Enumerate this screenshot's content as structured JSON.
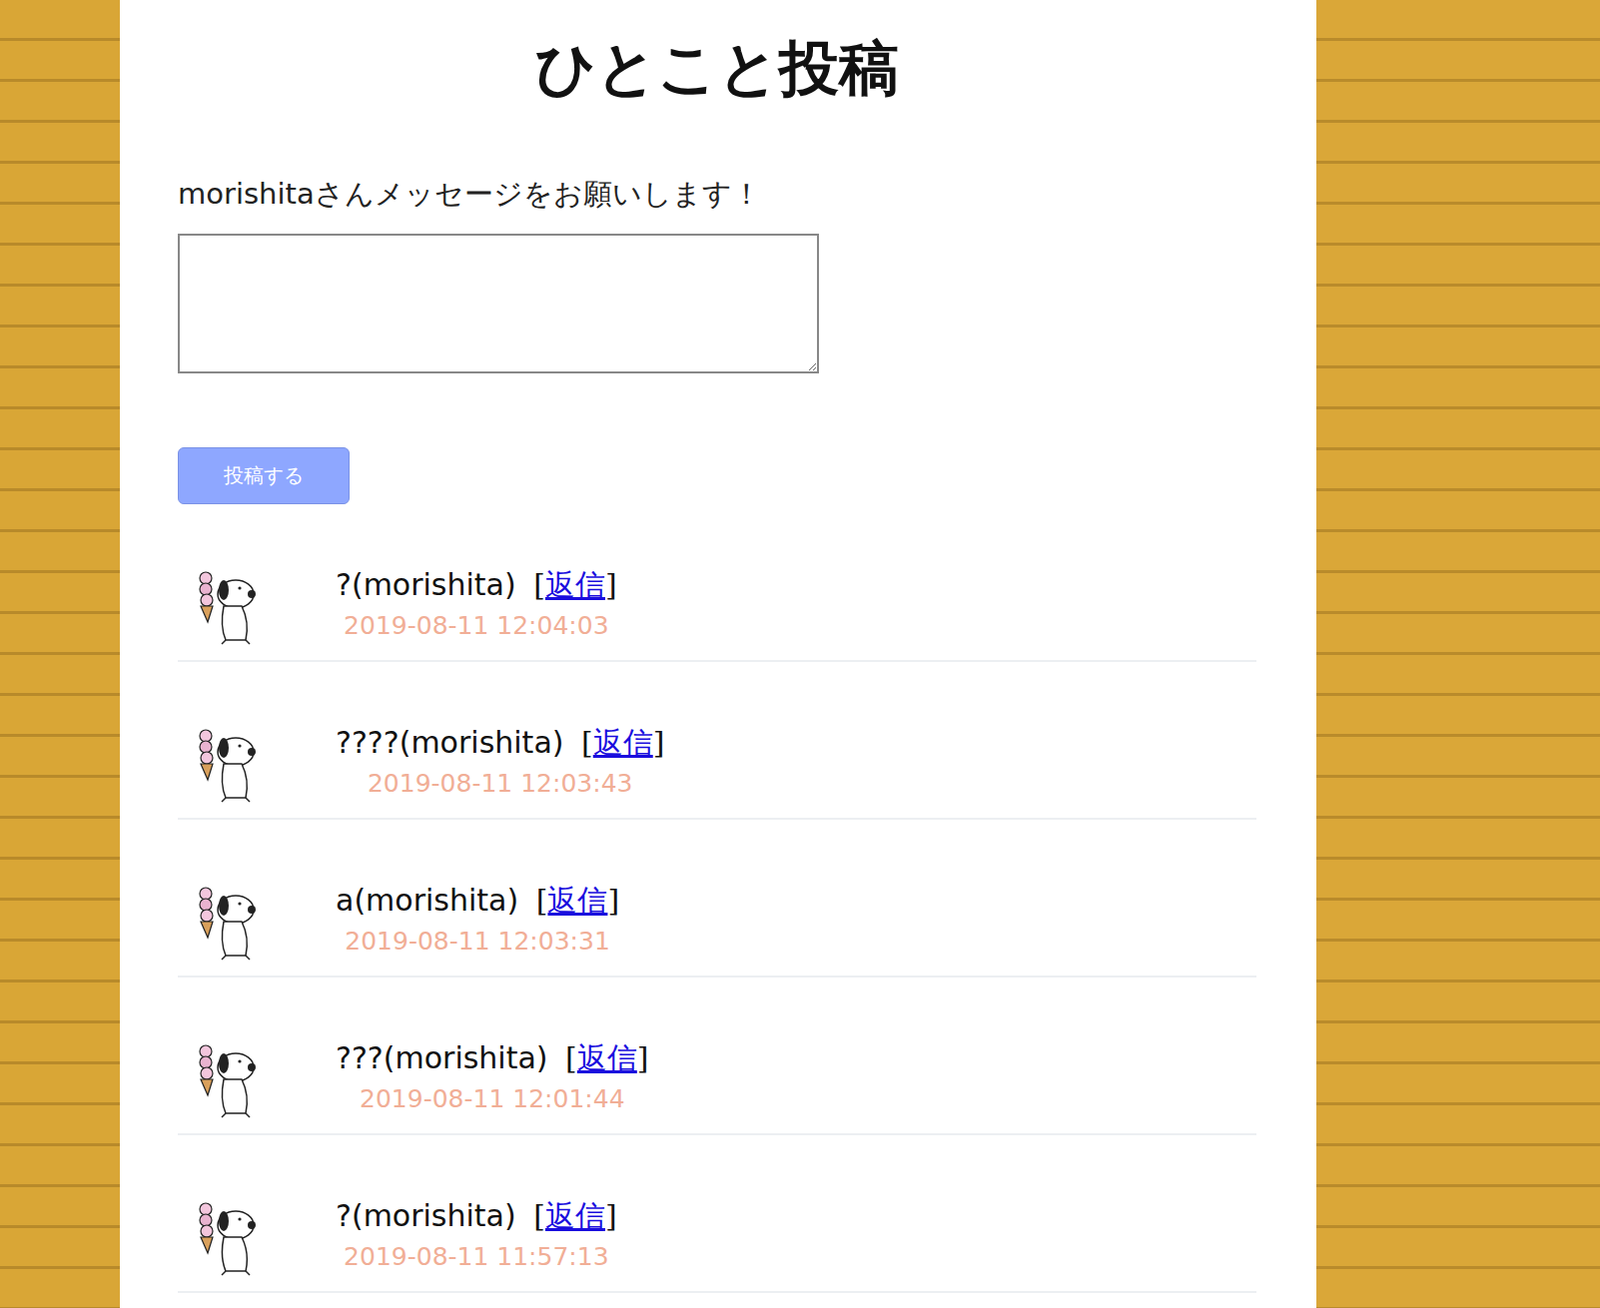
{
  "page": {
    "title": "ひとこと投稿"
  },
  "form": {
    "prompt": "morishitaさんメッセージをお願いします！",
    "message_value": "",
    "submit": "投稿する"
  },
  "posts": [
    {
      "text": "?(morishita)",
      "bracket_open": "[",
      "reply": "返信",
      "bracket_close": "]",
      "time": "2019-08-11 12:04:03"
    },
    {
      "text": "????(morishita)",
      "bracket_open": "[",
      "reply": "返信",
      "bracket_close": "]",
      "time": "2019-08-11 12:03:43"
    },
    {
      "text": "a(morishita)",
      "bracket_open": "[",
      "reply": "返信",
      "bracket_close": "]",
      "time": "2019-08-11 12:03:31"
    },
    {
      "text": "???(morishita)",
      "bracket_open": "[",
      "reply": "返信",
      "bracket_close": "]",
      "time": "2019-08-11 12:01:44"
    },
    {
      "text": "?(morishita)",
      "bracket_open": "[",
      "reply": "返信",
      "bracket_close": "]",
      "time": "2019-08-11 11:57:13"
    }
  ]
}
